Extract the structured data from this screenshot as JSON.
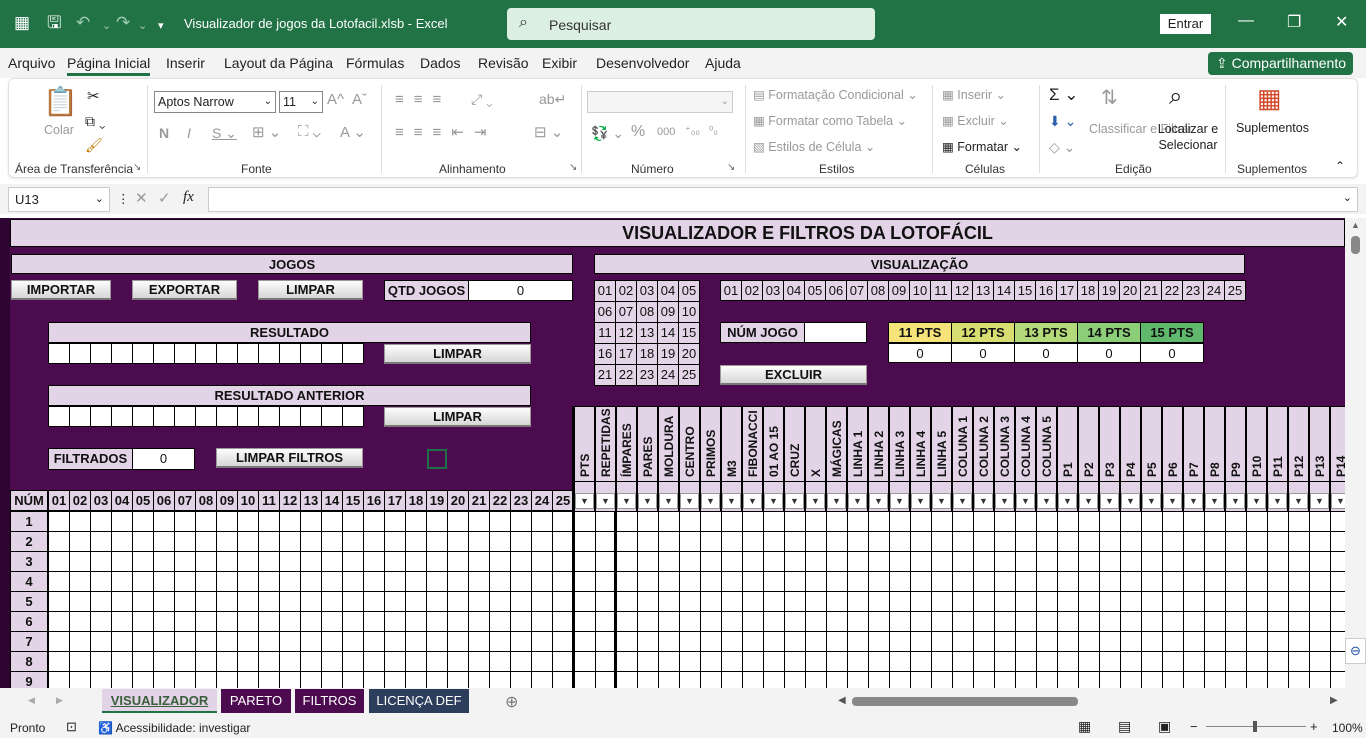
{
  "titlebar": {
    "doc_title": "Visualizador de jogos da Lotofacil.xlsb  -  Excel",
    "search_placeholder": "Pesquisar",
    "signin": "Entrar",
    "excel_icon": "excel-icon",
    "save_icon": "save-icon"
  },
  "menu": {
    "tabs": [
      "Arquivo",
      "Página Inicial",
      "Inserir",
      "Layout da Página",
      "Fórmulas",
      "Dados",
      "Revisão",
      "Exibir",
      "Desenvolvedor",
      "Ajuda"
    ],
    "share": "Compartilhamento"
  },
  "ribbon": {
    "paste": "Colar",
    "clipboard_label": "Área de Transferência",
    "font_name": "Aptos Narrow",
    "font_size": "11",
    "font_label": "Fonte",
    "alignment_label": "Alinhamento",
    "number_label": "Número",
    "styles": [
      "Formatação Condicional",
      "Formatar como Tabela",
      "Estilos de Célula"
    ],
    "styles_label": "Estilos",
    "cells": [
      "Inserir",
      "Excluir",
      "Formatar"
    ],
    "cells_label": "Células",
    "sort": "Classificar e Filtrar",
    "find": "Localizar e Selecionar",
    "editing_label": "Edição",
    "addins": "Suplementos",
    "addins_label": "Suplementos"
  },
  "formula": {
    "namebox": "U13",
    "fx": "fx"
  },
  "sheet": {
    "title": "VISUALIZADOR E FILTROS DA LOTOFÁCIL",
    "jogos": "JOGOS",
    "visualizacao": "VISUALIZAÇÃO",
    "importar": "IMPORTAR",
    "exportar": "EXPORTAR",
    "limpar": "LIMPAR",
    "qtd_jogos_label": "QTD JOGOS",
    "qtd_jogos_value": "0",
    "resultado": "RESULTADO",
    "resultado_anterior": "RESULTADO ANTERIOR",
    "filtrados_label": "FILTRADOS",
    "filtrados_value": "0",
    "limpar_filtros": "LIMPAR FILTROS",
    "num_jogo": "NÚM JOGO",
    "excluir": "EXCLUIR",
    "grid_numbers": [
      "01",
      "02",
      "03",
      "04",
      "05",
      "06",
      "07",
      "08",
      "09",
      "10",
      "11",
      "12",
      "13",
      "14",
      "15",
      "16",
      "17",
      "18",
      "19",
      "20",
      "21",
      "22",
      "23",
      "24",
      "25"
    ],
    "pts": [
      {
        "label": "11 PTS",
        "value": "0",
        "color": "#f6e47a"
      },
      {
        "label": "12 PTS",
        "value": "0",
        "color": "#d9de72"
      },
      {
        "label": "13 PTS",
        "value": "0",
        "color": "#b4d97a"
      },
      {
        "label": "14 PTS",
        "value": "0",
        "color": "#8ccd78"
      },
      {
        "label": "15 PTS",
        "value": "0",
        "color": "#5fb86c"
      }
    ],
    "num_header": "NÚM",
    "filter_columns": [
      "PTS",
      "REPETIDAS",
      "ÍMPARES",
      "PARES",
      "MOLDURA",
      "CENTRO",
      "PRIMOS",
      "M3",
      "FIBONACCI",
      "01 AO 15",
      "CRUZ",
      "X",
      "MÁGICAS",
      "LINHA 1",
      "LINHA 2",
      "LINHA 3",
      "LINHA 4",
      "LINHA 5",
      "COLUNA 1",
      "COLUNA 2",
      "COLUNA 3",
      "COLUNA 4",
      "COLUNA 5",
      "P1",
      "P2",
      "P3",
      "P4",
      "P5",
      "P6",
      "P7",
      "P8",
      "P9",
      "P10",
      "P11",
      "P12",
      "P13",
      "P14"
    ],
    "row_numbers": [
      "1",
      "2",
      "3",
      "4",
      "5",
      "6",
      "7",
      "8",
      "9"
    ]
  },
  "sheet_tabs": [
    {
      "label": "VISUALIZADOR",
      "active": true
    },
    {
      "label": "PARETO",
      "active": false
    },
    {
      "label": "FILTROS",
      "active": false
    },
    {
      "label": "LICENÇA DEF",
      "active": false
    }
  ],
  "status": {
    "ready": "Pronto",
    "accessibility": "Acessibilidade: investigar",
    "zoom": "100%"
  }
}
